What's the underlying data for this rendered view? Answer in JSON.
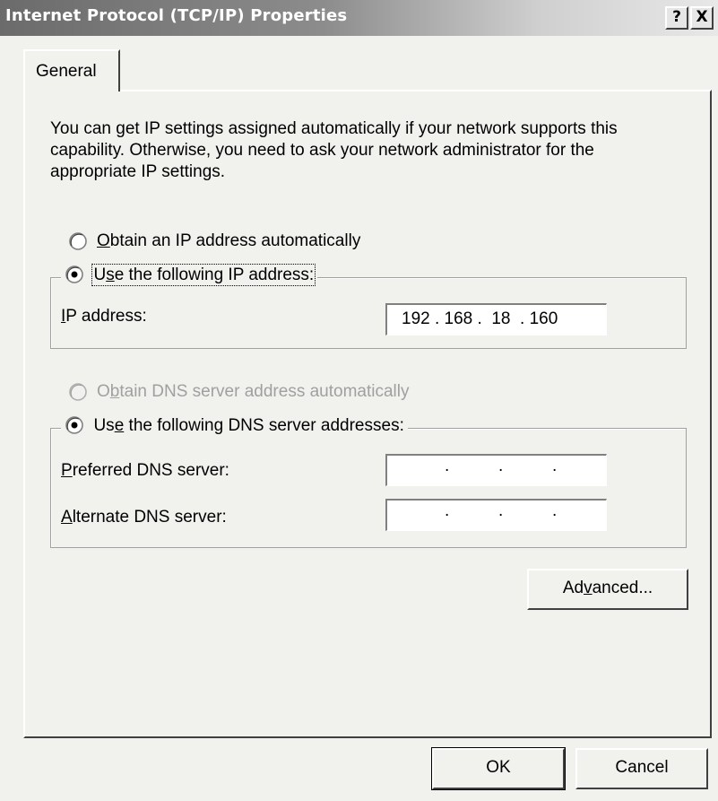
{
  "window": {
    "title": "Internet Protocol (TCP/IP) Properties",
    "help_glyph": "?",
    "close_glyph": "X"
  },
  "tabs": [
    {
      "label": "General"
    }
  ],
  "description": "You can get IP settings assigned automatically if your network supports this capability. Otherwise, you need to ask your network administrator for the appropriate IP settings.",
  "ip": {
    "auto_option": {
      "mnemonic": "O",
      "rest": "btain an IP address automatically",
      "selected": false
    },
    "manual_option": {
      "pre": "U",
      "mnemonic": "s",
      "rest": "e the following IP address:",
      "selected": true
    },
    "address_label": {
      "mnemonic": "I",
      "rest": "P address:"
    },
    "address_value": "192 . 168 .  18  . 160"
  },
  "dns": {
    "auto_option": {
      "pre": "O",
      "mnemonic": "b",
      "rest": "tain DNS server address automatically",
      "selected": false,
      "disabled": true
    },
    "manual_option": {
      "pre": "Us",
      "mnemonic": "e",
      "rest": " the following DNS server addresses:",
      "selected": true
    },
    "preferred_label": {
      "mnemonic": "P",
      "rest": "referred DNS server:"
    },
    "alternate_label": {
      "mnemonic": "A",
      "rest": "lternate DNS server:"
    },
    "preferred_value": "",
    "alternate_value": ""
  },
  "buttons": {
    "advanced": {
      "pre": "Ad",
      "mnemonic": "v",
      "rest": "anced..."
    },
    "ok": "OK",
    "cancel": "Cancel"
  }
}
